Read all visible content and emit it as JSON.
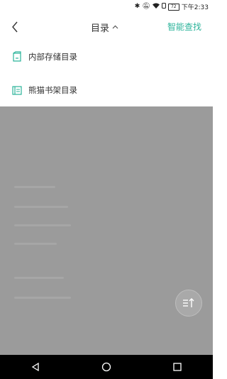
{
  "status_bar": {
    "time": "下午2:33",
    "battery": "72"
  },
  "header": {
    "title": "目录",
    "smart_search": "智能查找"
  },
  "menu": {
    "items": [
      {
        "label": "内部存储目录",
        "icon": "phone-storage-icon"
      },
      {
        "label": "熊猫书架目录",
        "icon": "bookshelf-icon"
      }
    ]
  },
  "colors": {
    "accent": "#2bb39a",
    "overlay": "#9b9b9b",
    "nav_bar": "#000000"
  }
}
